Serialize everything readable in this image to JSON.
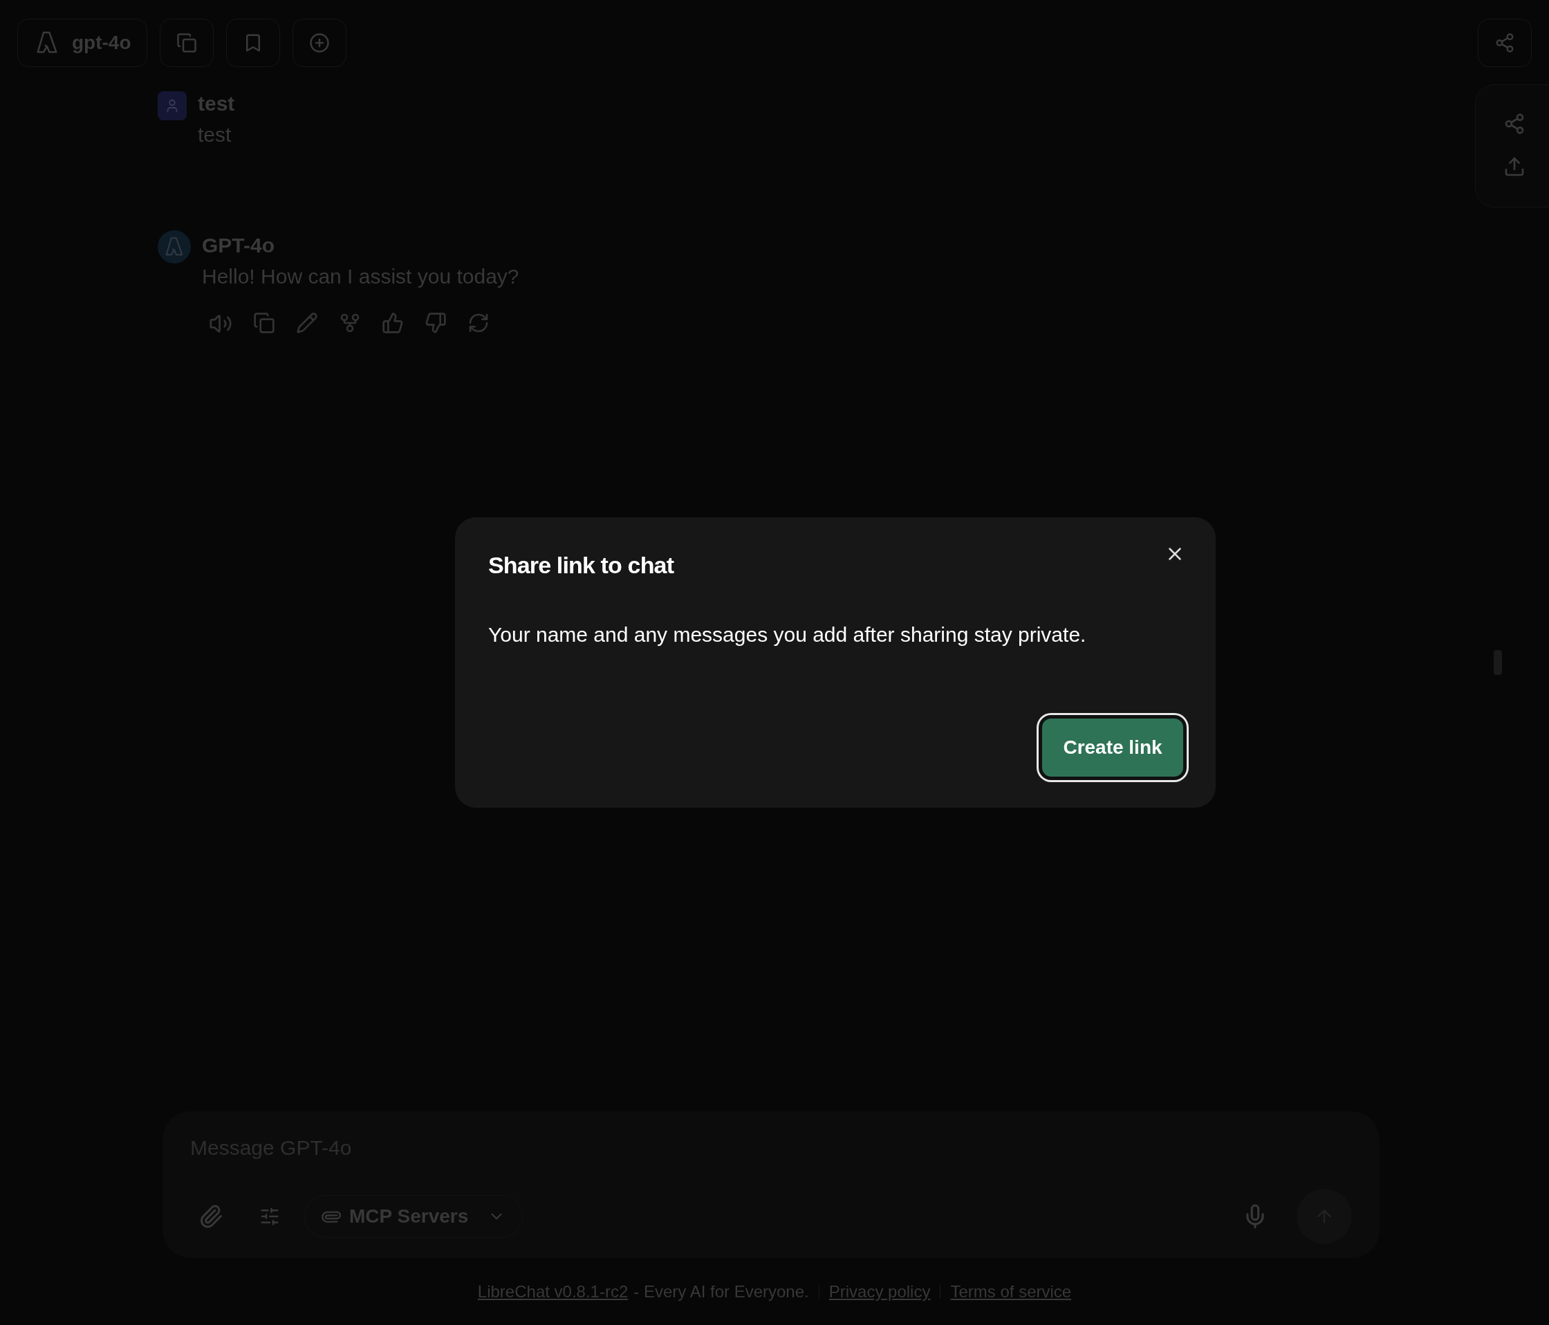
{
  "header": {
    "model": "gpt-4o"
  },
  "messages": [
    {
      "kind": "user",
      "author": "test",
      "text": "test"
    },
    {
      "kind": "assistant",
      "author": "GPT-4o",
      "text": "Hello! How can I assist you today?"
    }
  ],
  "dialog": {
    "title": "Share link to chat",
    "body": "Your name and any messages you add after sharing stay private.",
    "button": "Create link"
  },
  "composer": {
    "placeholder": "Message GPT-4o",
    "mcp": "MCP Servers"
  },
  "footer": {
    "version_link": "LibreChat v0.8.1-rc2",
    "tagline": "- Every AI for Everyone.",
    "links": [
      "Privacy policy",
      "Terms of service"
    ]
  }
}
